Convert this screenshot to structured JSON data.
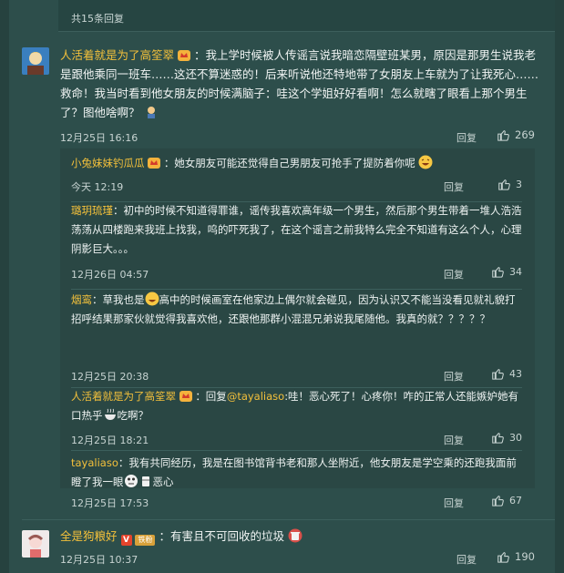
{
  "header": {
    "title": "共15条回复"
  },
  "comments": [
    {
      "user": "人活着就是为了高筌翠",
      "body": "：我上学时候被人传谣言说我暗恋隔壁班某男，原因是那男生说我老是跟他乘同一班车……这还不算迷惑的！后来听说他还特地带了女朋友上车就为了让我死心……救命！我当时看到他女朋友的时候满脑子：哇这个学姐好好看啊！怎么就瞎了眼看上那个男生了？图他啥啊？",
      "time": "12月25日 16:16",
      "reply": "回复",
      "likes": "269",
      "replies": [
        {
          "user": "小兔妹妹钓瓜瓜",
          "body": "：她女朋友可能还觉得自己男朋友可抢手了提防着你呢",
          "time": "今天 12:19",
          "reply": "回复",
          "likes": "3"
        },
        {
          "user": "璐玥琉瑾",
          "body": "：初中的时候不知道得罪谁，谣传我喜欢高年级一个男生，然后那个男生带着一堆人浩浩荡荡从四楼跑来我班上找我，呜的吓死我了，在这个谣言之前我特么完全不知道有这么个人，心理阴影巨大。。。",
          "time": "12月26日 04:57",
          "reply": "回复",
          "likes": "34"
        },
        {
          "user": "烟鸾",
          "body_pre": "：草我也是",
          "body_post": "高中的时候画室在他家边上偶尔就会碰见，因为认识又不能当没看见就礼貌打招呼结果那家伙就觉得我喜欢他，还跟他那群小混混兄弟说我尾随他。我真的就？？？？？",
          "time": "12月25日 20:38",
          "reply": "回复",
          "likes": "43"
        },
        {
          "user": "人活着就是为了高筌翠",
          "body_pre": "：回复",
          "mention": "@tayaliaso",
          "body_post": ":哇！恶心死了！心疼你！咋的正常人还能嫉妒她有口热乎",
          "body_tail": "吃啊？",
          "time": "12月25日 18:21",
          "reply": "回复",
          "likes": "30"
        },
        {
          "user": "tayaliaso",
          "body": "：我有共同经历，我是在图书馆背书老和那人坐附近，他女朋友是学空乘的还跑我面前瞪了我一眼",
          "body_tail": "恶心",
          "time": "12月25日 17:53",
          "reply": "回复",
          "likes": "67"
        }
      ]
    },
    {
      "user": "全是狗粮好",
      "badge_v": "V",
      "badge_fan": "铁粉",
      "body": "：有害且不可回收的垃圾",
      "time": "12月25日 10:37",
      "reply": "回复",
      "likes": "190"
    }
  ],
  "colors": {
    "username": "#f3c03b",
    "mention": "#f3c03b",
    "background": "#2d4e4b"
  }
}
